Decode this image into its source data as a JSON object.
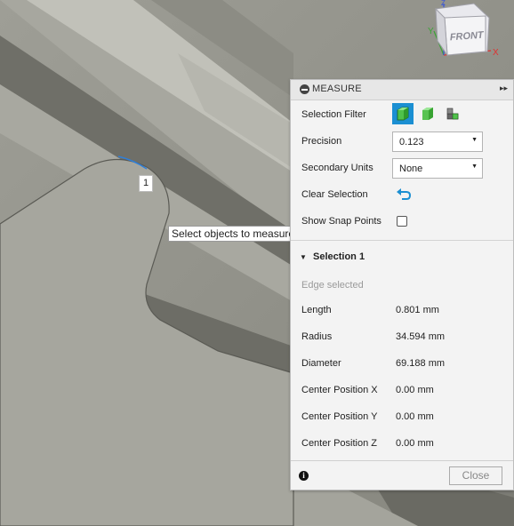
{
  "viewcube": {
    "face_label": "FRONT",
    "axis_x": "X",
    "axis_y": "Y",
    "axis_z": "Z"
  },
  "viewport": {
    "point_label": "1",
    "tooltip": "Select objects to measure."
  },
  "panel": {
    "title": "MEASURE",
    "selection_filter": {
      "label": "Selection Filter",
      "options": [
        "body-filter-icon",
        "face-filter-icon",
        "edge-filter-icon"
      ],
      "active_index": 0
    },
    "precision": {
      "label": "Precision",
      "value": "0.123"
    },
    "secondary_units": {
      "label": "Secondary Units",
      "value": "None"
    },
    "clear_selection": {
      "label": "Clear Selection"
    },
    "show_snap_points": {
      "label": "Show Snap Points",
      "checked": false
    },
    "selection": {
      "title": "Selection 1",
      "status": "Edge selected",
      "fields": [
        {
          "label": "Length",
          "value": "0.801 mm"
        },
        {
          "label": "Radius",
          "value": "34.594 mm"
        },
        {
          "label": "Diameter",
          "value": "69.188 mm"
        },
        {
          "label": "Center Position X",
          "value": "0.00 mm"
        },
        {
          "label": "Center Position Y",
          "value": "0.00 mm"
        },
        {
          "label": "Center Position Z",
          "value": "0.00 mm"
        }
      ]
    },
    "close_label": "Close"
  },
  "colors": {
    "accent": "#1b8fd2",
    "model": "#a3a39b"
  }
}
